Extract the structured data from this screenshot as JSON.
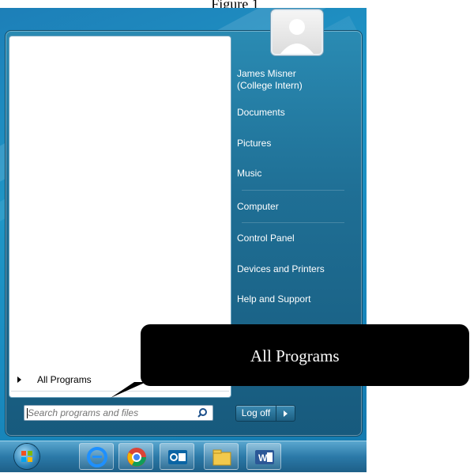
{
  "caption": "Figure 1",
  "user": {
    "name": "James Misner\n(College Intern)"
  },
  "right_menu": [
    {
      "label": "James Misner"
    },
    {
      "label": "(College Intern)"
    },
    {
      "label": "Documents"
    },
    {
      "label": "Pictures"
    },
    {
      "label": "Music"
    },
    {
      "label": "Computer"
    },
    {
      "label": "Control Panel"
    },
    {
      "label": "Devices and Printers"
    },
    {
      "label": "Help and Support"
    }
  ],
  "left_menu": {
    "all_programs_label": "All Programs"
  },
  "search": {
    "placeholder": "Search programs and files"
  },
  "logoff_label": "Log off",
  "callout_text": "All Programs",
  "taskbar": {
    "items": [
      "start-orb",
      "internet-explorer-icon",
      "chrome-icon",
      "outlook-icon",
      "file-explorer-icon",
      "word-icon"
    ]
  },
  "colors": {
    "desktop": "#1f96c6",
    "menu_glass": "#1f6f95",
    "callout": "#000000"
  }
}
